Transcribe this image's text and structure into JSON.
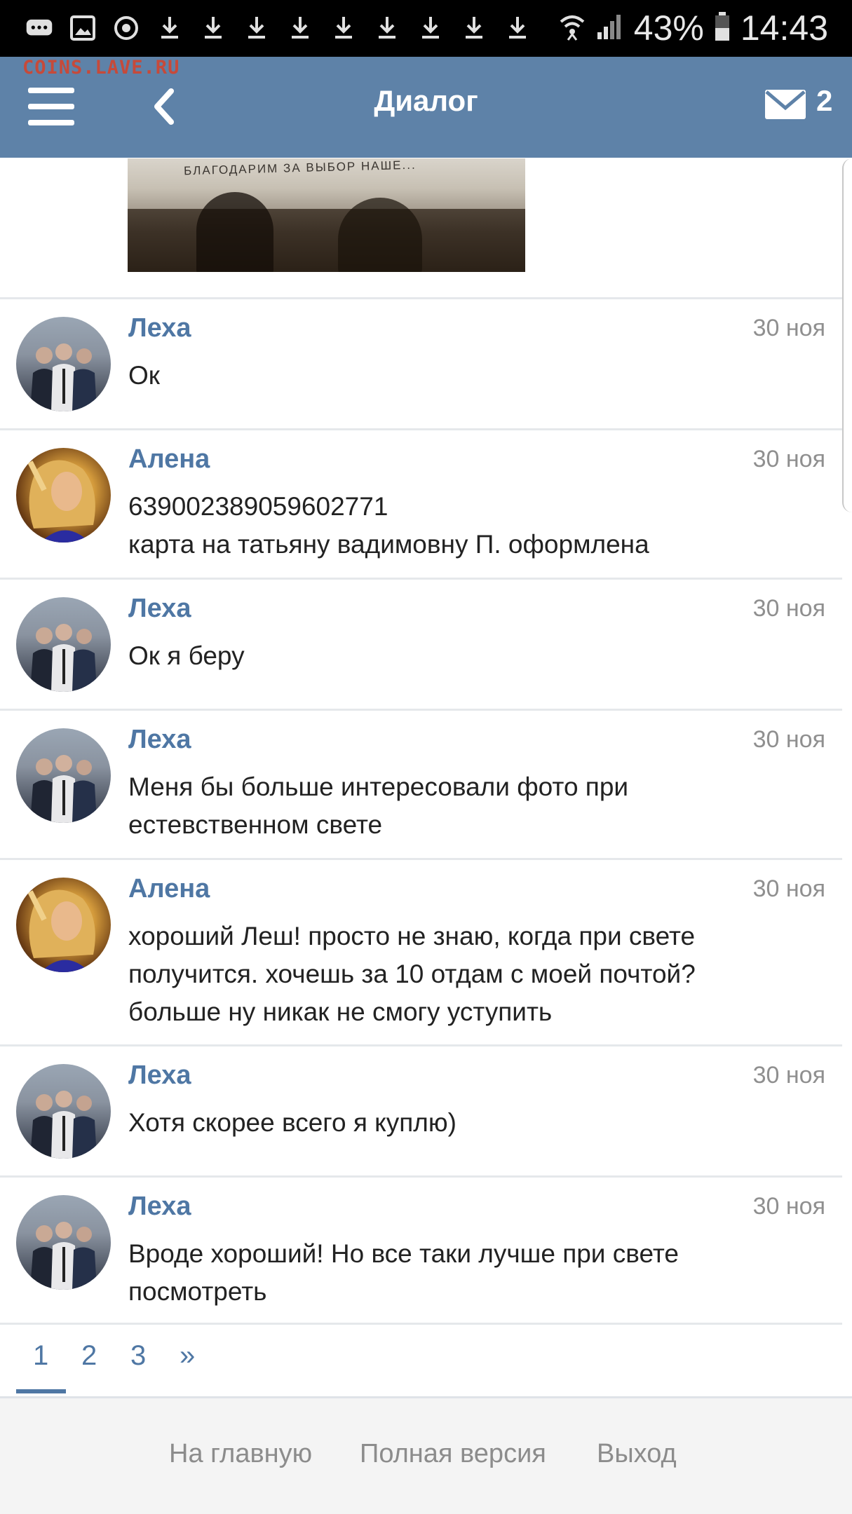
{
  "status_bar": {
    "battery": "43%",
    "time": "14:43"
  },
  "watermark": "COINS.LAVE.RU",
  "header": {
    "title": "Диалог",
    "mail_count": "2"
  },
  "photo": {
    "caption": "БЛАГОДАРИМ ЗА ВЫБОР НАШЕ..."
  },
  "messages": [
    {
      "author": "Леха",
      "date": "30 ноя",
      "lines": [
        "Ок"
      ]
    },
    {
      "author": "Алена",
      "date": "30 ноя",
      "lines": [
        "639002389059602771",
        "карта на татьяну вадимовну П. оформлена"
      ]
    },
    {
      "author": "Леха",
      "date": "30 ноя",
      "lines": [
        "Ок я беру"
      ]
    },
    {
      "author": "Леха",
      "date": "30 ноя",
      "lines": [
        "Меня бы больше интересовали фото при",
        "естевственном свете"
      ]
    },
    {
      "author": "Алена",
      "date": "30 ноя",
      "lines": [
        "хороший Леш! просто не знаю, когда при свете",
        "получится. хочешь за 10 отдам с моей почтой?",
        "больше ну никак не смогу уступить"
      ]
    },
    {
      "author": "Леха",
      "date": "30 ноя",
      "lines": [
        "Хотя скорее всего я куплю)"
      ]
    },
    {
      "author": "Леха",
      "date": "30 ноя",
      "lines": [
        "Вроде хороший! Но все таки лучше при свете",
        "посмотреть"
      ]
    }
  ],
  "pager": {
    "pages": [
      "1",
      "2",
      "3"
    ],
    "next": "»",
    "current": "1"
  },
  "footer": {
    "home": "На главную",
    "full_version": "Полная версия",
    "logout": "Выход"
  }
}
